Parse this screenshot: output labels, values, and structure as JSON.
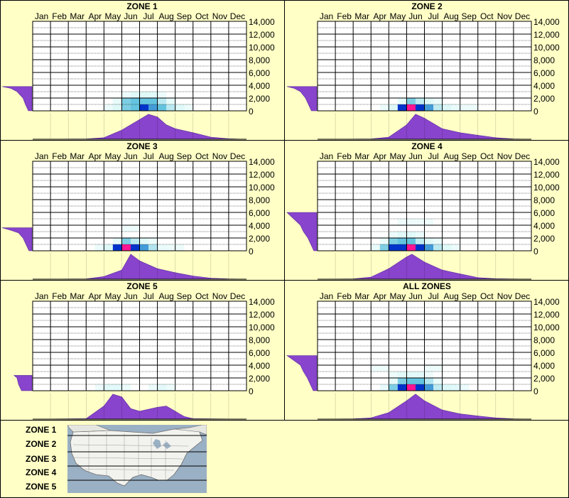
{
  "months": [
    "Jan",
    "Feb",
    "Mar",
    "Apr",
    "May",
    "Jun",
    "Jul",
    "Aug",
    "Sep",
    "Oct",
    "Nov",
    "Dec"
  ],
  "y_ticks": [
    "14,000",
    "12,000",
    "10,000",
    "8,000",
    "6,000",
    "4,000",
    "2,000",
    "0"
  ],
  "colors": {
    "background": "#ffffc6",
    "density": "#8844cc",
    "heat_low": "#d9f7f7",
    "heat_mid": "#59bfdc",
    "heat_high": "#0033cc",
    "heat_peak": "#ff1493"
  },
  "chart_data": [
    {
      "type": "heatmap",
      "title": "ZONE 1",
      "ylim": [
        0,
        14000
      ],
      "x_categories": [
        "Jan",
        "Feb",
        "Mar",
        "Apr",
        "May",
        "Jun",
        "Jul",
        "Aug",
        "Sep",
        "Oct",
        "Nov",
        "Dec"
      ],
      "cells": [
        {
          "month": 4.5,
          "y": 500,
          "v": 0.15
        },
        {
          "month": 5,
          "y": 500,
          "v": 0.3
        },
        {
          "month": 5.5,
          "y": 500,
          "v": 0.45
        },
        {
          "month": 6,
          "y": 500,
          "v": 0.6
        },
        {
          "month": 6.5,
          "y": 500,
          "v": 0.7
        },
        {
          "month": 7,
          "y": 500,
          "v": 0.6
        },
        {
          "month": 7.5,
          "y": 500,
          "v": 0.45
        },
        {
          "month": 8,
          "y": 500,
          "v": 0.3
        },
        {
          "month": 8.5,
          "y": 500,
          "v": 0.15
        },
        {
          "month": 5,
          "y": 1500,
          "v": 0.25
        },
        {
          "month": 5.5,
          "y": 1500,
          "v": 0.4
        },
        {
          "month": 6,
          "y": 1500,
          "v": 0.55
        },
        {
          "month": 6.5,
          "y": 1500,
          "v": 0.6
        },
        {
          "month": 7,
          "y": 1500,
          "v": 0.5
        },
        {
          "month": 7.5,
          "y": 1500,
          "v": 0.3
        },
        {
          "month": 5.5,
          "y": 2500,
          "v": 0.15
        },
        {
          "month": 6,
          "y": 2500,
          "v": 0.25
        },
        {
          "month": 6.5,
          "y": 2500,
          "v": 0.25
        },
        {
          "month": 7,
          "y": 2500,
          "v": 0.15
        }
      ],
      "month_density": [
        [
          0,
          0
        ],
        [
          3,
          0.01
        ],
        [
          4,
          0.06
        ],
        [
          5,
          0.35
        ],
        [
          6,
          0.75
        ],
        [
          6.5,
          0.95
        ],
        [
          7,
          0.85
        ],
        [
          7.5,
          0.55
        ],
        [
          8,
          0.4
        ],
        [
          9,
          0.25
        ],
        [
          10,
          0.08
        ],
        [
          11,
          0.02
        ],
        [
          12,
          0
        ]
      ],
      "elev_density": [
        [
          0,
          0.12
        ],
        [
          1000,
          0.22
        ],
        [
          2000,
          0.3
        ],
        [
          3000,
          0.5
        ],
        [
          3500,
          0.7
        ],
        [
          3800,
          1.0
        ]
      ]
    },
    {
      "type": "heatmap",
      "title": "ZONE 2",
      "ylim": [
        0,
        14000
      ],
      "x_categories": [
        "Jan",
        "Feb",
        "Mar",
        "Apr",
        "May",
        "Jun",
        "Jul",
        "Aug",
        "Sep",
        "Oct",
        "Nov",
        "Dec"
      ],
      "cells": [
        {
          "month": 4,
          "y": 500,
          "v": 0.15
        },
        {
          "month": 4.5,
          "y": 500,
          "v": 0.35
        },
        {
          "month": 5,
          "y": 500,
          "v": 0.7
        },
        {
          "month": 5.5,
          "y": 500,
          "v": 1.0
        },
        {
          "month": 6,
          "y": 500,
          "v": 0.85
        },
        {
          "month": 6.5,
          "y": 500,
          "v": 0.55
        },
        {
          "month": 7,
          "y": 500,
          "v": 0.35
        },
        {
          "month": 7.5,
          "y": 500,
          "v": 0.2
        },
        {
          "month": 8.5,
          "y": 500,
          "v": 0.12
        },
        {
          "month": 5,
          "y": 1500,
          "v": 0.3
        },
        {
          "month": 5.5,
          "y": 1500,
          "v": 0.5
        },
        {
          "month": 6,
          "y": 1500,
          "v": 0.35
        },
        {
          "month": 6.5,
          "y": 1500,
          "v": 0.15
        }
      ],
      "month_density": [
        [
          0,
          0
        ],
        [
          3,
          0.01
        ],
        [
          4,
          0.08
        ],
        [
          5,
          0.55
        ],
        [
          5.5,
          0.95
        ],
        [
          6,
          0.8
        ],
        [
          7,
          0.4
        ],
        [
          8,
          0.25
        ],
        [
          9,
          0.15
        ],
        [
          10,
          0.06
        ],
        [
          11,
          0.01
        ],
        [
          12,
          0
        ]
      ],
      "elev_density": [
        [
          0,
          0.18
        ],
        [
          1000,
          0.28
        ],
        [
          2000,
          0.38
        ],
        [
          3000,
          0.55
        ],
        [
          3500,
          0.75
        ],
        [
          3800,
          1.0
        ]
      ]
    },
    {
      "type": "heatmap",
      "title": "ZONE 3",
      "ylim": [
        0,
        14000
      ],
      "x_categories": [
        "Jan",
        "Feb",
        "Mar",
        "Apr",
        "May",
        "Jun",
        "Jul",
        "Aug",
        "Sep",
        "Oct",
        "Nov",
        "Dec"
      ],
      "cells": [
        {
          "month": 4,
          "y": 500,
          "v": 0.15
        },
        {
          "month": 4.5,
          "y": 500,
          "v": 0.35
        },
        {
          "month": 5,
          "y": 500,
          "v": 0.75
        },
        {
          "month": 5.5,
          "y": 500,
          "v": 1.0
        },
        {
          "month": 6,
          "y": 500,
          "v": 0.8
        },
        {
          "month": 6.5,
          "y": 500,
          "v": 0.4
        },
        {
          "month": 7,
          "y": 500,
          "v": 0.2
        },
        {
          "month": 8,
          "y": 500,
          "v": 0.12
        },
        {
          "month": 5,
          "y": 1500,
          "v": 0.3
        },
        {
          "month": 5.5,
          "y": 1500,
          "v": 0.5
        },
        {
          "month": 6,
          "y": 1500,
          "v": 0.3
        },
        {
          "month": 6.5,
          "y": 1500,
          "v": 0.12
        },
        {
          "month": 5.5,
          "y": 3500,
          "v": 0.08
        }
      ],
      "month_density": [
        [
          0,
          0
        ],
        [
          3,
          0.01
        ],
        [
          4,
          0.1
        ],
        [
          5,
          0.35
        ],
        [
          5.5,
          0.95
        ],
        [
          6,
          0.7
        ],
        [
          7,
          0.4
        ],
        [
          8,
          0.25
        ],
        [
          9,
          0.12
        ],
        [
          10,
          0.04
        ],
        [
          11,
          0.01
        ],
        [
          12,
          0
        ]
      ],
      "elev_density": [
        [
          0,
          0.1
        ],
        [
          1000,
          0.2
        ],
        [
          2000,
          0.3
        ],
        [
          2800,
          0.45
        ],
        [
          3200,
          0.7
        ],
        [
          3600,
          1.0
        ]
      ]
    },
    {
      "type": "heatmap",
      "title": "ZONE 4",
      "ylim": [
        0,
        14000
      ],
      "x_categories": [
        "Jan",
        "Feb",
        "Mar",
        "Apr",
        "May",
        "Jun",
        "Jul",
        "Aug",
        "Sep",
        "Oct",
        "Nov",
        "Dec"
      ],
      "cells": [
        {
          "month": 3.5,
          "y": 500,
          "v": 0.2
        },
        {
          "month": 4,
          "y": 500,
          "v": 0.45
        },
        {
          "month": 4.5,
          "y": 500,
          "v": 0.75
        },
        {
          "month": 5,
          "y": 500,
          "v": 0.9
        },
        {
          "month": 5.5,
          "y": 500,
          "v": 1.0
        },
        {
          "month": 6,
          "y": 500,
          "v": 0.8
        },
        {
          "month": 6.5,
          "y": 500,
          "v": 0.5
        },
        {
          "month": 7,
          "y": 500,
          "v": 0.3
        },
        {
          "month": 7.5,
          "y": 500,
          "v": 0.15
        },
        {
          "month": 4,
          "y": 1500,
          "v": 0.25
        },
        {
          "month": 4.5,
          "y": 1500,
          "v": 0.45
        },
        {
          "month": 5,
          "y": 1500,
          "v": 0.55
        },
        {
          "month": 5.5,
          "y": 1500,
          "v": 0.5
        },
        {
          "month": 6,
          "y": 1500,
          "v": 0.35
        },
        {
          "month": 6.5,
          "y": 1500,
          "v": 0.2
        },
        {
          "month": 4.5,
          "y": 2500,
          "v": 0.15
        },
        {
          "month": 5,
          "y": 2500,
          "v": 0.2
        },
        {
          "month": 5.5,
          "y": 2500,
          "v": 0.15
        },
        {
          "month": 5,
          "y": 4500,
          "v": 0.08
        },
        {
          "month": 6,
          "y": 4500,
          "v": 0.08
        }
      ],
      "month_density": [
        [
          0,
          0
        ],
        [
          2,
          0.01
        ],
        [
          3,
          0.08
        ],
        [
          4,
          0.4
        ],
        [
          5,
          0.85
        ],
        [
          5.3,
          0.95
        ],
        [
          6,
          0.65
        ],
        [
          7,
          0.35
        ],
        [
          8,
          0.2
        ],
        [
          9,
          0.06
        ],
        [
          10,
          0.02
        ],
        [
          12,
          0
        ]
      ],
      "elev_density": [
        [
          0,
          0.1
        ],
        [
          1000,
          0.2
        ],
        [
          2000,
          0.3
        ],
        [
          3000,
          0.45
        ],
        [
          4000,
          0.55
        ],
        [
          6000,
          1.0
        ]
      ]
    },
    {
      "type": "heatmap",
      "title": "ZONE 5",
      "ylim": [
        0,
        14000
      ],
      "x_categories": [
        "Jan",
        "Feb",
        "Mar",
        "Apr",
        "May",
        "Jun",
        "Jul",
        "Aug",
        "Sep",
        "Oct",
        "Nov",
        "Dec"
      ],
      "cells": [
        {
          "month": 4,
          "y": 500,
          "v": 0.12
        },
        {
          "month": 4.5,
          "y": 500,
          "v": 0.2
        },
        {
          "month": 5,
          "y": 500,
          "v": 0.15
        },
        {
          "month": 7,
          "y": 500,
          "v": 0.1
        },
        {
          "month": 7.5,
          "y": 500,
          "v": 0.12
        }
      ],
      "month_density": [
        [
          0,
          0
        ],
        [
          3,
          0.02
        ],
        [
          4,
          0.5
        ],
        [
          4.5,
          0.95
        ],
        [
          5,
          0.85
        ],
        [
          5.5,
          0.4
        ],
        [
          6,
          0.3
        ],
        [
          7,
          0.45
        ],
        [
          7.5,
          0.5
        ],
        [
          8,
          0.3
        ],
        [
          8.5,
          0.1
        ],
        [
          9,
          0.02
        ],
        [
          12,
          0
        ]
      ],
      "elev_density": [
        [
          0,
          0.35
        ],
        [
          1000,
          0.45
        ],
        [
          2000,
          0.5
        ],
        [
          2400,
          0.6
        ]
      ]
    },
    {
      "type": "heatmap",
      "title": "ALL ZONES",
      "ylim": [
        0,
        14000
      ],
      "x_categories": [
        "Jan",
        "Feb",
        "Mar",
        "Apr",
        "May",
        "Jun",
        "Jul",
        "Aug",
        "Sep",
        "Oct",
        "Nov",
        "Dec"
      ],
      "cells": [
        {
          "month": 4,
          "y": 500,
          "v": 0.25
        },
        {
          "month": 4.5,
          "y": 500,
          "v": 0.45
        },
        {
          "month": 5,
          "y": 500,
          "v": 0.75
        },
        {
          "month": 5.5,
          "y": 500,
          "v": 1.0
        },
        {
          "month": 6,
          "y": 500,
          "v": 0.8
        },
        {
          "month": 6.5,
          "y": 500,
          "v": 0.5
        },
        {
          "month": 7,
          "y": 500,
          "v": 0.35
        },
        {
          "month": 7.5,
          "y": 500,
          "v": 0.25
        },
        {
          "month": 8,
          "y": 500,
          "v": 0.15
        },
        {
          "month": 4.5,
          "y": 1500,
          "v": 0.3
        },
        {
          "month": 5,
          "y": 1500,
          "v": 0.5
        },
        {
          "month": 5.5,
          "y": 1500,
          "v": 0.55
        },
        {
          "month": 6,
          "y": 1500,
          "v": 0.4
        },
        {
          "month": 6.5,
          "y": 1500,
          "v": 0.2
        },
        {
          "month": 4.5,
          "y": 2500,
          "v": 0.12
        },
        {
          "month": 5,
          "y": 2500,
          "v": 0.15
        },
        {
          "month": 5.5,
          "y": 2500,
          "v": 0.15
        },
        {
          "month": 6,
          "y": 2500,
          "v": 0.1
        },
        {
          "month": 3.5,
          "y": 3500,
          "v": 0.06
        },
        {
          "month": 6.5,
          "y": 3500,
          "v": 0.06
        }
      ],
      "month_density": [
        [
          0,
          0
        ],
        [
          2,
          0.01
        ],
        [
          3,
          0.05
        ],
        [
          4,
          0.25
        ],
        [
          5,
          0.7
        ],
        [
          5.5,
          0.95
        ],
        [
          6,
          0.7
        ],
        [
          7,
          0.35
        ],
        [
          8,
          0.2
        ],
        [
          9,
          0.12
        ],
        [
          10,
          0.05
        ],
        [
          11,
          0.01
        ],
        [
          12,
          0
        ]
      ],
      "elev_density": [
        [
          0,
          0.12
        ],
        [
          1000,
          0.22
        ],
        [
          2000,
          0.32
        ],
        [
          3000,
          0.45
        ],
        [
          4000,
          0.55
        ],
        [
          5500,
          1.0
        ]
      ]
    }
  ],
  "legend": {
    "zone_labels": [
      "ZONE 1",
      "ZONE 2",
      "ZONE 3",
      "ZONE 4",
      "ZONE 5"
    ]
  }
}
